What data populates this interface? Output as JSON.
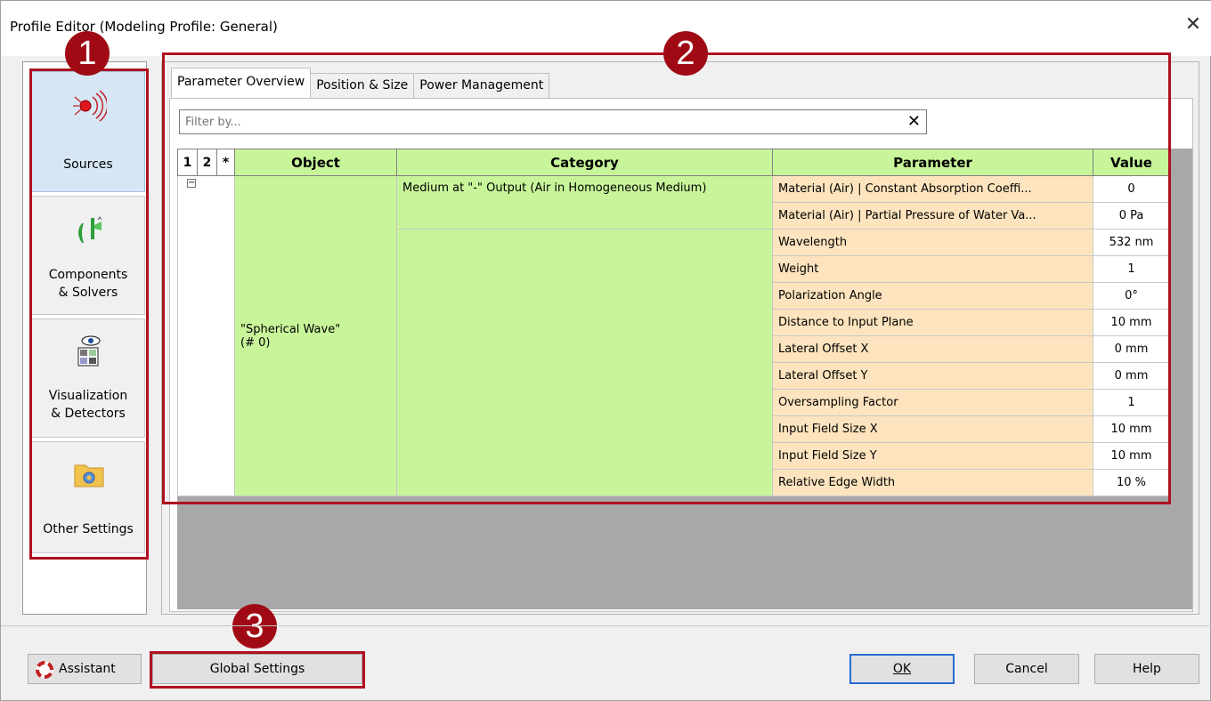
{
  "window": {
    "title": "Profile Editor (Modeling Profile: General)"
  },
  "nav": {
    "items": [
      {
        "label": "Sources",
        "active": true
      },
      {
        "label": "Components\n& Solvers"
      },
      {
        "label": "Visualization\n& Detectors"
      },
      {
        "label": "Other Settings"
      }
    ]
  },
  "tabs": [
    "Parameter Overview",
    "Position & Size",
    "Power Management"
  ],
  "filter": {
    "placeholder": "Filter by...",
    "value": ""
  },
  "grid": {
    "headers": {
      "c1": "1",
      "c2": "2",
      "c3": "*",
      "object": "Object",
      "category": "Category",
      "parameter": "Parameter",
      "value": "Value"
    },
    "object": "\"Spherical Wave\"\n(# 0)",
    "category": "Medium at \"-\" Output (Air in Homogeneous Medium)",
    "rows": [
      {
        "parameter": "Material (Air) | Constant Absorption Coeffi...",
        "value": "0"
      },
      {
        "parameter": "Material (Air) | Partial Pressure of Water Va...",
        "value": "0 Pa"
      },
      {
        "parameter": "Wavelength",
        "value": "532 nm"
      },
      {
        "parameter": "Weight",
        "value": "1"
      },
      {
        "parameter": "Polarization Angle",
        "value": "0°"
      },
      {
        "parameter": "Distance to Input Plane",
        "value": "10 mm"
      },
      {
        "parameter": "Lateral Offset X",
        "value": "0 mm"
      },
      {
        "parameter": "Lateral Offset Y",
        "value": "0 mm"
      },
      {
        "parameter": "Oversampling Factor",
        "value": "1"
      },
      {
        "parameter": "Input Field Size X",
        "value": "10 mm"
      },
      {
        "parameter": "Input Field Size Y",
        "value": "10 mm"
      },
      {
        "parameter": "Relative Edge Width",
        "value": "10 %"
      }
    ]
  },
  "badges": [
    "1",
    "2",
    "3"
  ],
  "buttons": {
    "assistant": "Assistant",
    "global_settings": "Global Settings",
    "ok": "OK",
    "cancel": "Cancel",
    "help": "Help"
  },
  "colors": {
    "annotation_red": "#b01020",
    "green_cell": "#c8f59a",
    "param_cell": "#fde4be"
  }
}
